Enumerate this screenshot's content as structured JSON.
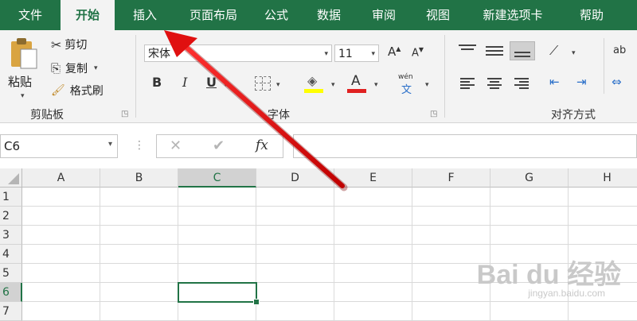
{
  "menu": {
    "items": [
      "文件",
      "开始",
      "插入",
      "页面布局",
      "公式",
      "数据",
      "审阅",
      "视图",
      "新建选项卡",
      "帮助"
    ],
    "active_index": 1
  },
  "ribbon": {
    "clipboard": {
      "paste": "粘贴",
      "cut": "剪切",
      "copy": "复制",
      "format_painter": "格式刷",
      "group_label": "剪贴板"
    },
    "font": {
      "font_name": "宋体",
      "font_size": "11",
      "bold": "B",
      "italic": "I",
      "underline": "U",
      "font_color_glyph": "A",
      "wen_top": "wén",
      "wen_char": "文",
      "group_label": "字体"
    },
    "alignment": {
      "group_label": "对齐方式",
      "wrap_glyph": "ab"
    }
  },
  "formula_bar": {
    "name_box": "C6",
    "cancel_glyph": "✕",
    "enter_glyph": "✔",
    "fx_label": "fx",
    "formula_value": ""
  },
  "sheet": {
    "columns": [
      "A",
      "B",
      "C",
      "D",
      "E",
      "F",
      "G",
      "H"
    ],
    "rows": [
      "1",
      "2",
      "3",
      "4",
      "5",
      "6",
      "7"
    ],
    "selected_column": "C",
    "selected_row": "6"
  },
  "watermark": {
    "text": "Bai du 经验",
    "sub": "jingyan.baidu.com"
  },
  "colors": {
    "accent": "#217346",
    "arrow": "#e01010",
    "font_color_bar": "#e02020",
    "highlight_bar": "#ffff00"
  }
}
